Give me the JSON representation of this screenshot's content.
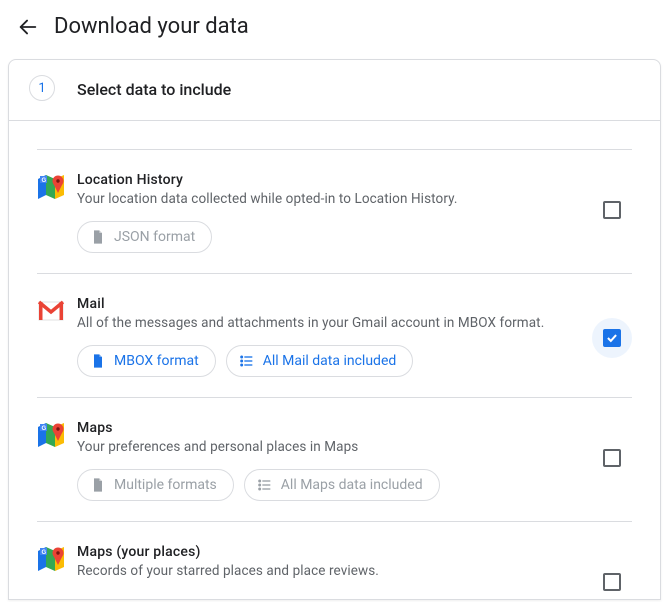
{
  "page_title": "Download your data",
  "step": {
    "number": "1",
    "title": "Select data to include"
  },
  "products": {
    "location_history": {
      "title": "Location History",
      "desc": "Your location data collected while opted-in to Location History.",
      "format_chip": "JSON format",
      "checked": false
    },
    "mail": {
      "title": "Mail",
      "desc": "All of the messages and attachments in your Gmail account in MBOX format.",
      "format_chip": "MBOX format",
      "scope_chip": "All Mail data included",
      "checked": true
    },
    "maps": {
      "title": "Maps",
      "desc": "Your preferences and personal places in Maps",
      "format_chip": "Multiple formats",
      "scope_chip": "All Maps data included",
      "checked": false
    },
    "maps_places": {
      "title": "Maps (your places)",
      "desc": "Records of your starred places and place reviews.",
      "checked": false
    }
  }
}
